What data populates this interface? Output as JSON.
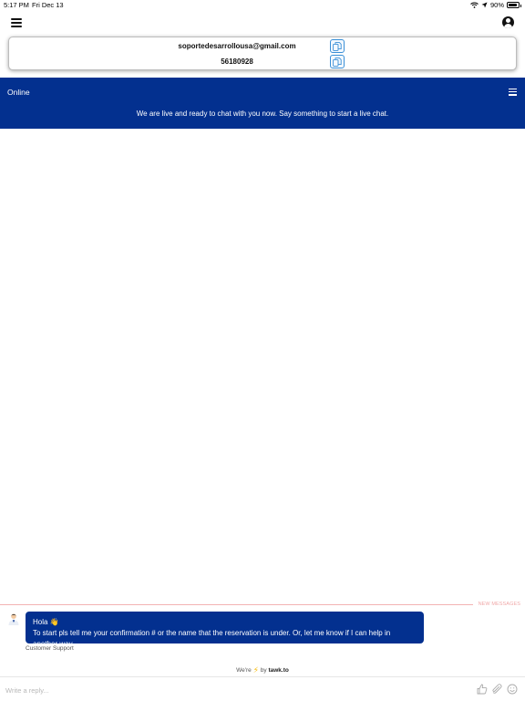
{
  "status_bar": {
    "time": "5:17 PM",
    "date": "Fri Dec 13",
    "battery": "90%",
    "battery_level": 0.9
  },
  "contact": {
    "email": "soportedesarrollousa@gmail.com",
    "phone": "56180928"
  },
  "chat": {
    "status": "Online",
    "intro": "We are live and ready to chat with you now. Say something to start a live chat.",
    "new_messages_label": "NEW MESSAGES",
    "message": {
      "greeting": "Hola 👋",
      "text": "To start pls tell me your confirmation # or the name that the reservation is under. Or, let me know if I can help in another way.",
      "sender": "Customer Support"
    },
    "powered_by": {
      "prefix": "We're",
      "middle": "by",
      "brand": "tawk.to"
    },
    "composer": {
      "placeholder": "Write a reply..."
    }
  },
  "colors": {
    "brand": "#03308f",
    "copy_accent": "#3a8fd6",
    "new_messages": "#f0a8a8"
  },
  "icons": [
    "menu-icon",
    "account-icon",
    "copy-icon",
    "wifi-icon",
    "location-arrow-icon",
    "battery-icon",
    "thumbs-up-icon",
    "paperclip-icon",
    "emoji-icon",
    "bolt-icon"
  ]
}
